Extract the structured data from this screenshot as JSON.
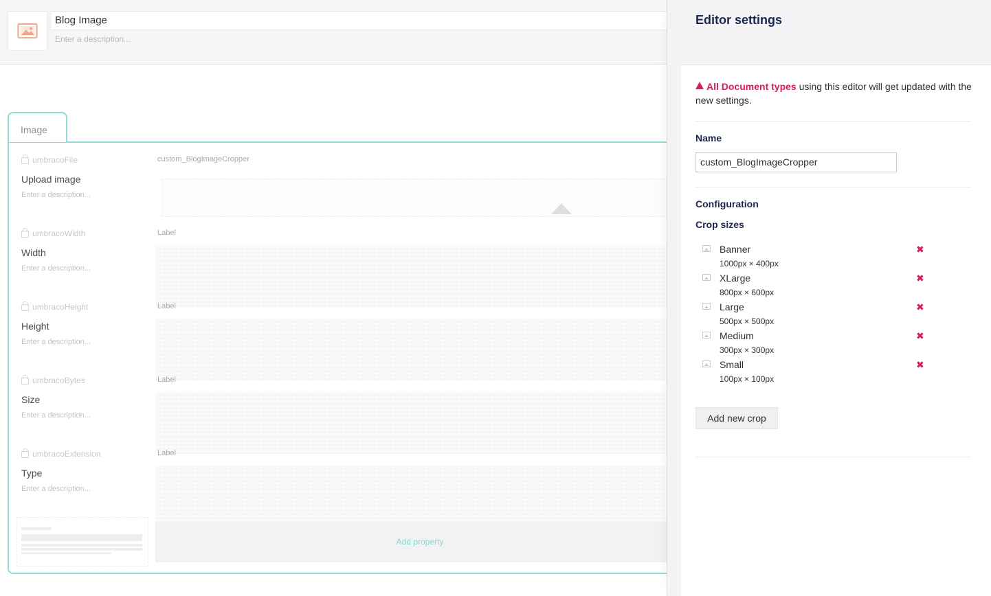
{
  "doc_type": {
    "name": "Blog Image",
    "description_placeholder": "Enter a description...",
    "icon": "picture-icon"
  },
  "tabs": [
    {
      "label": "Image"
    }
  ],
  "properties": [
    {
      "alias": "umbracoFile",
      "label": "Upload image",
      "description": "Enter a description...",
      "editor": "custom_BlogImageCropper"
    },
    {
      "alias": "umbracoWidth",
      "label": "Width",
      "description": "Enter a description...",
      "editor": "Label"
    },
    {
      "alias": "umbracoHeight",
      "label": "Height",
      "description": "Enter a description...",
      "editor": "Label"
    },
    {
      "alias": "umbracoBytes",
      "label": "Size",
      "description": "Enter a description...",
      "editor": "Label"
    },
    {
      "alias": "umbracoExtension",
      "label": "Type",
      "description": "Enter a description...",
      "editor": "Label"
    }
  ],
  "add_property_label": "Add property",
  "panel": {
    "title": "Editor settings",
    "warning_highlight": "All Document types",
    "warning_text": " using this editor will get updated with the new settings.",
    "name_label": "Name",
    "name_value": "custom_BlogImageCropper",
    "configuration_label": "Configuration",
    "crop_sizes_label": "Crop sizes",
    "crops": [
      {
        "name": "Banner",
        "size": "1000px × 400px"
      },
      {
        "name": "XLarge",
        "size": "800px × 600px"
      },
      {
        "name": "Large",
        "size": "500px × 500px"
      },
      {
        "name": "Medium",
        "size": "300px × 300px"
      },
      {
        "name": "Small",
        "size": "100px × 100px"
      }
    ],
    "delete_glyph": "✖",
    "add_crop_label": "Add new crop"
  },
  "colors": {
    "accent": "#8fdcd6",
    "danger": "#d42054",
    "icon": "#f0a98a"
  }
}
